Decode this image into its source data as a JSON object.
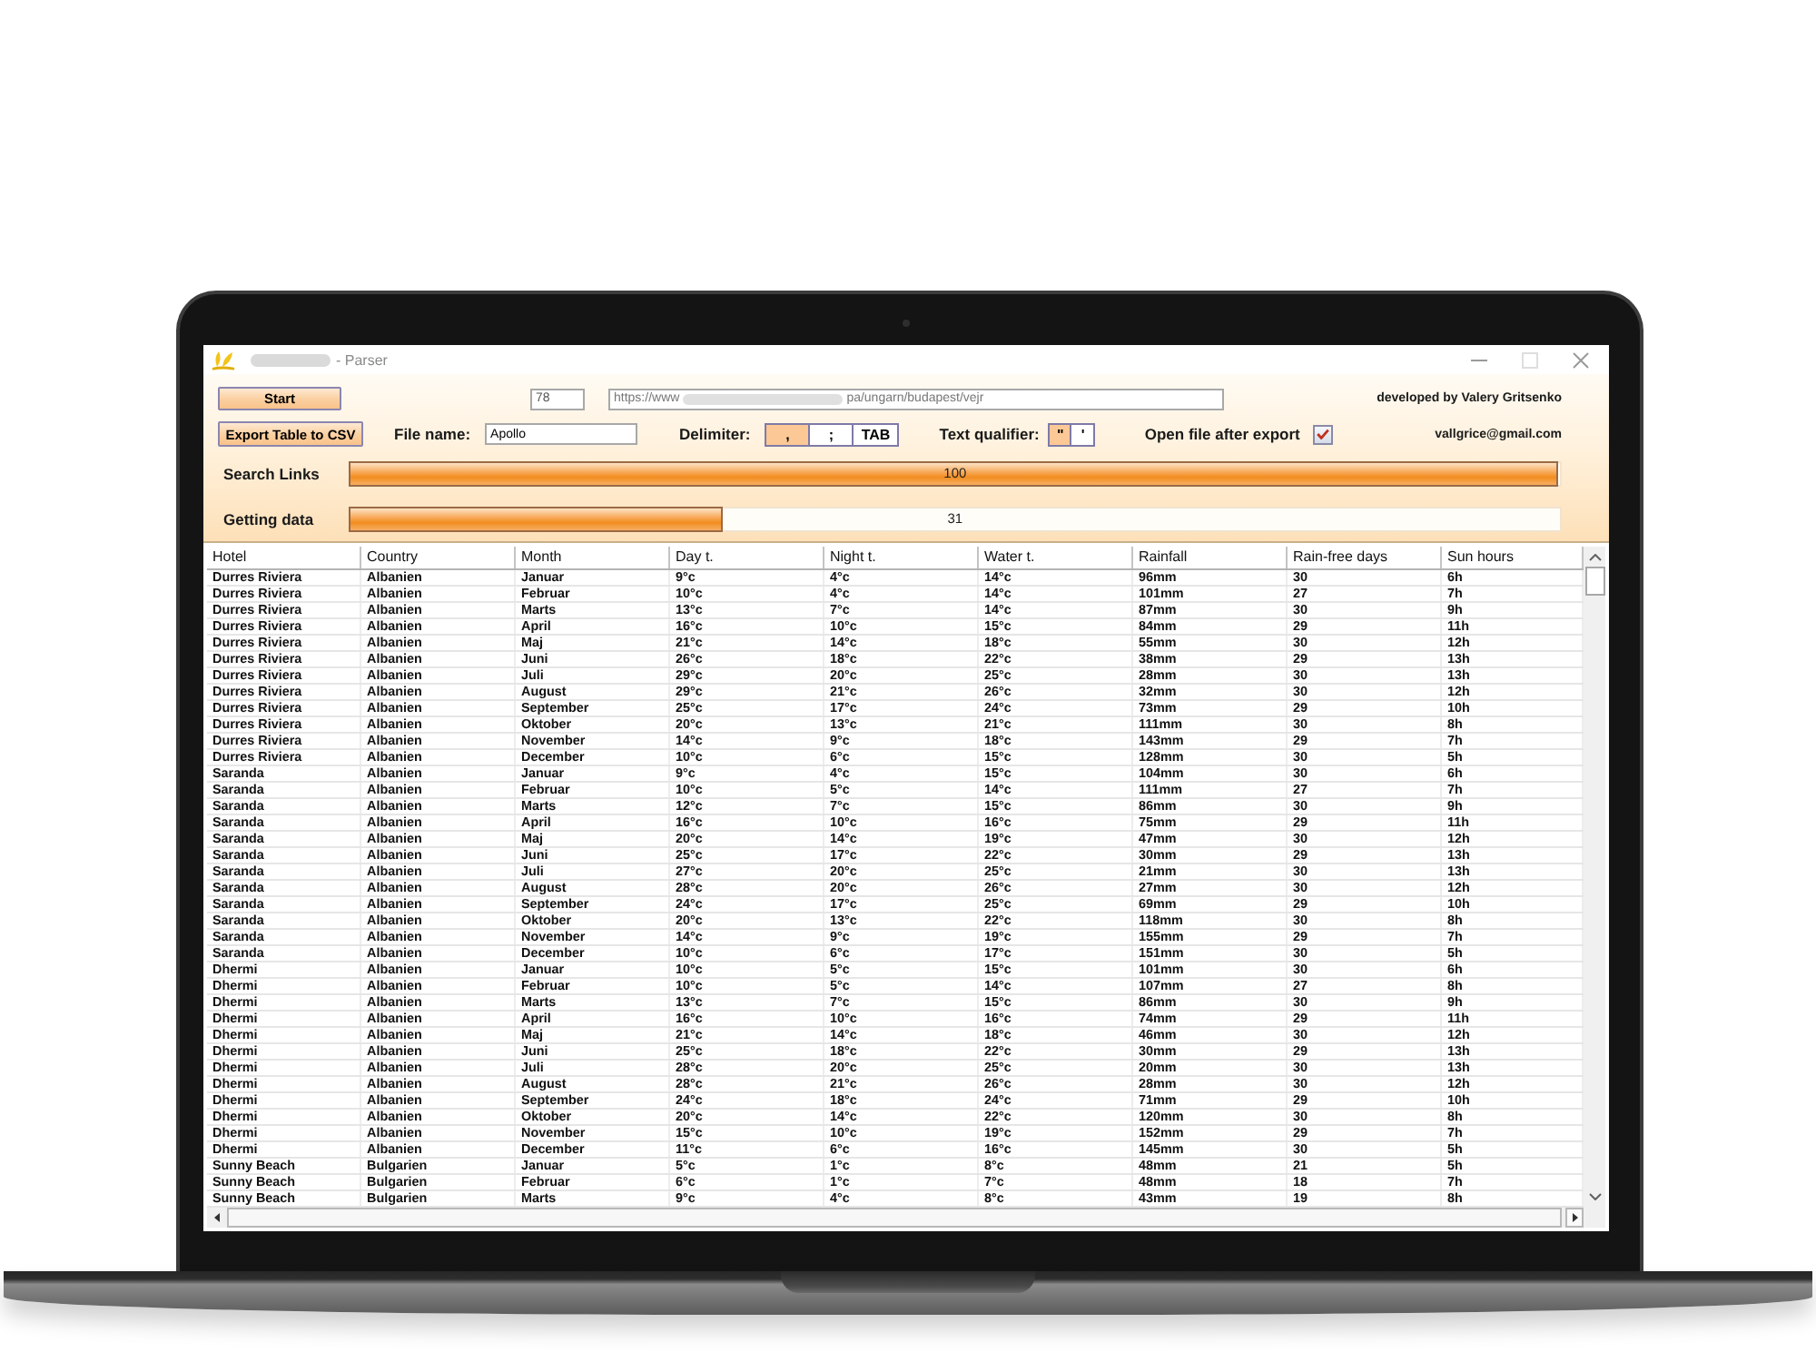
{
  "window": {
    "title": "- Parser"
  },
  "toolbar": {
    "start_button": "Start",
    "count_field": {
      "value": "78"
    },
    "url_field": {
      "value_parts": [
        "https://www",
        "pa/ungarn/budapest/vejr"
      ]
    },
    "credit": "developed by Valery Gritsenko",
    "export_button": "Export Table to CSV",
    "file_name": {
      "label": "File name:",
      "value": "Apollo"
    },
    "delimiter": {
      "label": "Delimiter:",
      "options": [
        {
          "label": ",",
          "selected": true
        },
        {
          "label": ";",
          "selected": false
        },
        {
          "label": "TAB",
          "selected": false
        }
      ]
    },
    "text_qualifier": {
      "label": "Text qualifier:",
      "options": [
        {
          "label": "\"",
          "selected": true
        },
        {
          "label": "'",
          "selected": false
        }
      ]
    },
    "open_after_export": {
      "label": "Open file after export",
      "checked": true
    },
    "email": "vallgrice@gmail.com"
  },
  "progress": [
    {
      "label": "Search Links",
      "level": 1.0,
      "reading": "100"
    },
    {
      "label": "Getting data",
      "level": 0.31,
      "reading": "31"
    }
  ],
  "table": {
    "columns": [
      "Hotel",
      "Country",
      "Month",
      "Day t.",
      "Night t.",
      "Water t.",
      "Rainfall",
      "Rain-free days",
      "Sun hours"
    ],
    "rows": [
      [
        "Durres Riviera",
        "Albanien",
        "Januar",
        "9°c",
        "4°c",
        "14°c",
        "96mm",
        "30",
        "6h"
      ],
      [
        "Durres Riviera",
        "Albanien",
        "Februar",
        "10°c",
        "4°c",
        "14°c",
        "101mm",
        "27",
        "7h"
      ],
      [
        "Durres Riviera",
        "Albanien",
        "Marts",
        "13°c",
        "7°c",
        "14°c",
        "87mm",
        "30",
        "9h"
      ],
      [
        "Durres Riviera",
        "Albanien",
        "April",
        "16°c",
        "10°c",
        "15°c",
        "84mm",
        "29",
        "11h"
      ],
      [
        "Durres Riviera",
        "Albanien",
        "Maj",
        "21°c",
        "14°c",
        "18°c",
        "55mm",
        "30",
        "12h"
      ],
      [
        "Durres Riviera",
        "Albanien",
        "Juni",
        "26°c",
        "18°c",
        "22°c",
        "38mm",
        "29",
        "13h"
      ],
      [
        "Durres Riviera",
        "Albanien",
        "Juli",
        "29°c",
        "20°c",
        "25°c",
        "28mm",
        "30",
        "13h"
      ],
      [
        "Durres Riviera",
        "Albanien",
        "August",
        "29°c",
        "21°c",
        "26°c",
        "32mm",
        "30",
        "12h"
      ],
      [
        "Durres Riviera",
        "Albanien",
        "September",
        "25°c",
        "17°c",
        "24°c",
        "73mm",
        "29",
        "10h"
      ],
      [
        "Durres Riviera",
        "Albanien",
        "Oktober",
        "20°c",
        "13°c",
        "21°c",
        "111mm",
        "30",
        "8h"
      ],
      [
        "Durres Riviera",
        "Albanien",
        "November",
        "14°c",
        "9°c",
        "18°c",
        "143mm",
        "29",
        "7h"
      ],
      [
        "Durres Riviera",
        "Albanien",
        "December",
        "10°c",
        "6°c",
        "15°c",
        "128mm",
        "30",
        "5h"
      ],
      [
        "Saranda",
        "Albanien",
        "Januar",
        "9°c",
        "4°c",
        "15°c",
        "104mm",
        "30",
        "6h"
      ],
      [
        "Saranda",
        "Albanien",
        "Februar",
        "10°c",
        "5°c",
        "14°c",
        "111mm",
        "27",
        "7h"
      ],
      [
        "Saranda",
        "Albanien",
        "Marts",
        "12°c",
        "7°c",
        "15°c",
        "86mm",
        "30",
        "9h"
      ],
      [
        "Saranda",
        "Albanien",
        "April",
        "16°c",
        "10°c",
        "16°c",
        "75mm",
        "29",
        "11h"
      ],
      [
        "Saranda",
        "Albanien",
        "Maj",
        "20°c",
        "14°c",
        "19°c",
        "47mm",
        "30",
        "12h"
      ],
      [
        "Saranda",
        "Albanien",
        "Juni",
        "25°c",
        "17°c",
        "22°c",
        "30mm",
        "29",
        "13h"
      ],
      [
        "Saranda",
        "Albanien",
        "Juli",
        "27°c",
        "20°c",
        "25°c",
        "21mm",
        "30",
        "13h"
      ],
      [
        "Saranda",
        "Albanien",
        "August",
        "28°c",
        "20°c",
        "26°c",
        "27mm",
        "30",
        "12h"
      ],
      [
        "Saranda",
        "Albanien",
        "September",
        "24°c",
        "17°c",
        "25°c",
        "69mm",
        "29",
        "10h"
      ],
      [
        "Saranda",
        "Albanien",
        "Oktober",
        "20°c",
        "13°c",
        "22°c",
        "118mm",
        "30",
        "8h"
      ],
      [
        "Saranda",
        "Albanien",
        "November",
        "14°c",
        "9°c",
        "19°c",
        "155mm",
        "29",
        "7h"
      ],
      [
        "Saranda",
        "Albanien",
        "December",
        "10°c",
        "6°c",
        "17°c",
        "151mm",
        "30",
        "5h"
      ],
      [
        "Dhermi",
        "Albanien",
        "Januar",
        "10°c",
        "5°c",
        "15°c",
        "101mm",
        "30",
        "6h"
      ],
      [
        "Dhermi",
        "Albanien",
        "Februar",
        "10°c",
        "5°c",
        "14°c",
        "107mm",
        "27",
        "8h"
      ],
      [
        "Dhermi",
        "Albanien",
        "Marts",
        "13°c",
        "7°c",
        "15°c",
        "86mm",
        "30",
        "9h"
      ],
      [
        "Dhermi",
        "Albanien",
        "April",
        "16°c",
        "10°c",
        "16°c",
        "74mm",
        "29",
        "11h"
      ],
      [
        "Dhermi",
        "Albanien",
        "Maj",
        "21°c",
        "14°c",
        "18°c",
        "46mm",
        "30",
        "12h"
      ],
      [
        "Dhermi",
        "Albanien",
        "Juni",
        "25°c",
        "18°c",
        "22°c",
        "30mm",
        "29",
        "13h"
      ],
      [
        "Dhermi",
        "Albanien",
        "Juli",
        "28°c",
        "20°c",
        "25°c",
        "20mm",
        "30",
        "13h"
      ],
      [
        "Dhermi",
        "Albanien",
        "August",
        "28°c",
        "21°c",
        "26°c",
        "28mm",
        "30",
        "12h"
      ],
      [
        "Dhermi",
        "Albanien",
        "September",
        "24°c",
        "18°c",
        "24°c",
        "71mm",
        "29",
        "10h"
      ],
      [
        "Dhermi",
        "Albanien",
        "Oktober",
        "20°c",
        "14°c",
        "22°c",
        "120mm",
        "30",
        "8h"
      ],
      [
        "Dhermi",
        "Albanien",
        "November",
        "15°c",
        "10°c",
        "19°c",
        "152mm",
        "29",
        "7h"
      ],
      [
        "Dhermi",
        "Albanien",
        "December",
        "11°c",
        "6°c",
        "16°c",
        "145mm",
        "30",
        "5h"
      ],
      [
        "Sunny Beach",
        "Bulgarien",
        "Januar",
        "5°c",
        "1°c",
        "8°c",
        "48mm",
        "21",
        "5h"
      ],
      [
        "Sunny Beach",
        "Bulgarien",
        "Februar",
        "6°c",
        "1°c",
        "7°c",
        "48mm",
        "18",
        "7h"
      ],
      [
        "Sunny Beach",
        "Bulgarien",
        "Marts",
        "9°c",
        "4°c",
        "8°c",
        "43mm",
        "19",
        "8h"
      ]
    ]
  }
}
